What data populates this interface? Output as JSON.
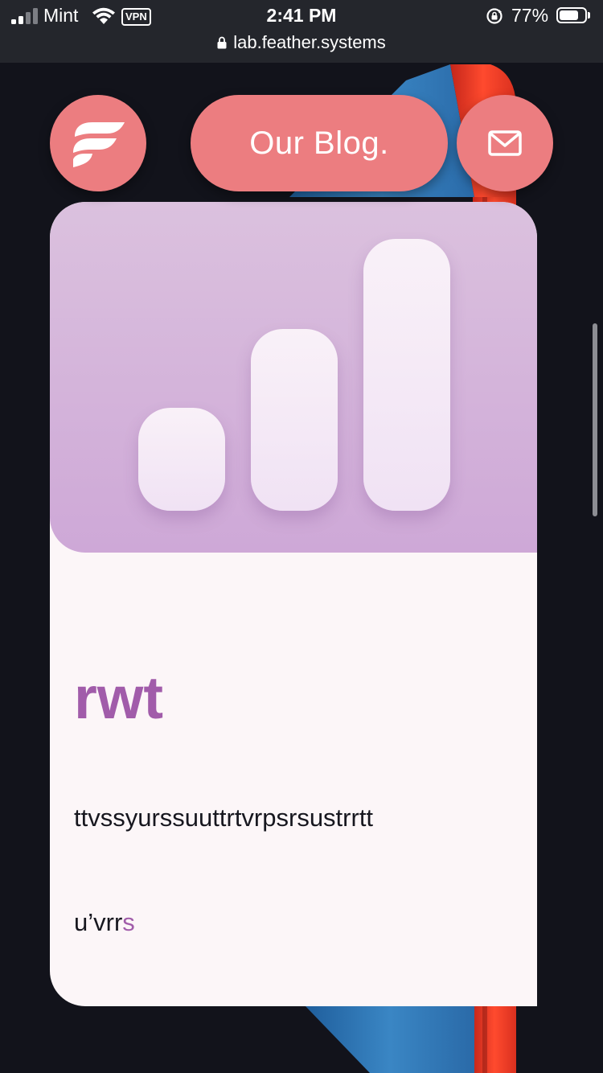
{
  "status_bar": {
    "carrier": "Mint",
    "vpn_label": "VPN",
    "time": "2:41 PM",
    "battery_percent": "77%",
    "battery_level": 0.77,
    "signal_bars_active": 2,
    "signal_bars_total": 4
  },
  "browser": {
    "url": "lab.feather.systems"
  },
  "nav": {
    "logo_icon": "feather-logo-icon",
    "blog_label": "Our Blog.",
    "mail_icon": "envelope-icon",
    "button_color": "#ec7d80"
  },
  "card": {
    "hero_icon": "bar-chart-icon",
    "bar_levels": [
      0.38,
      0.67,
      1.0
    ],
    "title": "rwt",
    "body": "ttvssyurssuuttrtvrpsrsustrrtt",
    "link_text_plain": "u’vrr",
    "link_text_accent": "s",
    "accent_color": "#a15caa",
    "hero_gradient": [
      "#dbc1de",
      "#cea8d7"
    ]
  },
  "colors": {
    "background": "#12131b",
    "card_background": "#fcf6f8"
  }
}
